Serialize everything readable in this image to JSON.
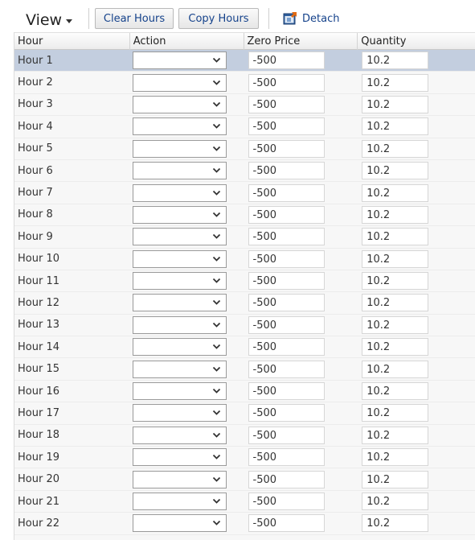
{
  "toolbar": {
    "view_label": "View",
    "clear_hours_label": "Clear Hours",
    "copy_hours_label": "Copy Hours",
    "detach_label": "Detach"
  },
  "columns": {
    "hour": "Hour",
    "action": "Action",
    "zero_price": "Zero Price",
    "quantity": "Quantity"
  },
  "rows": [
    {
      "hour": "Hour 1",
      "action": "",
      "zero_price": "-500",
      "quantity": "10.2"
    },
    {
      "hour": "Hour 2",
      "action": "",
      "zero_price": "-500",
      "quantity": "10.2"
    },
    {
      "hour": "Hour 3",
      "action": "",
      "zero_price": "-500",
      "quantity": "10.2"
    },
    {
      "hour": "Hour 4",
      "action": "",
      "zero_price": "-500",
      "quantity": "10.2"
    },
    {
      "hour": "Hour 5",
      "action": "",
      "zero_price": "-500",
      "quantity": "10.2"
    },
    {
      "hour": "Hour 6",
      "action": "",
      "zero_price": "-500",
      "quantity": "10.2"
    },
    {
      "hour": "Hour 7",
      "action": "",
      "zero_price": "-500",
      "quantity": "10.2"
    },
    {
      "hour": "Hour 8",
      "action": "",
      "zero_price": "-500",
      "quantity": "10.2"
    },
    {
      "hour": "Hour 9",
      "action": "",
      "zero_price": "-500",
      "quantity": "10.2"
    },
    {
      "hour": "Hour 10",
      "action": "",
      "zero_price": "-500",
      "quantity": "10.2"
    },
    {
      "hour": "Hour 11",
      "action": "",
      "zero_price": "-500",
      "quantity": "10.2"
    },
    {
      "hour": "Hour 12",
      "action": "",
      "zero_price": "-500",
      "quantity": "10.2"
    },
    {
      "hour": "Hour 13",
      "action": "",
      "zero_price": "-500",
      "quantity": "10.2"
    },
    {
      "hour": "Hour 14",
      "action": "",
      "zero_price": "-500",
      "quantity": "10.2"
    },
    {
      "hour": "Hour 15",
      "action": "",
      "zero_price": "-500",
      "quantity": "10.2"
    },
    {
      "hour": "Hour 16",
      "action": "",
      "zero_price": "-500",
      "quantity": "10.2"
    },
    {
      "hour": "Hour 17",
      "action": "",
      "zero_price": "-500",
      "quantity": "10.2"
    },
    {
      "hour": "Hour 18",
      "action": "",
      "zero_price": "-500",
      "quantity": "10.2"
    },
    {
      "hour": "Hour 19",
      "action": "",
      "zero_price": "-500",
      "quantity": "10.2"
    },
    {
      "hour": "Hour 20",
      "action": "",
      "zero_price": "-500",
      "quantity": "10.2"
    },
    {
      "hour": "Hour 21",
      "action": "",
      "zero_price": "-500",
      "quantity": "10.2"
    },
    {
      "hour": "Hour 22",
      "action": "",
      "zero_price": "-500",
      "quantity": "10.2"
    }
  ],
  "selected_row": 0,
  "icons": {
    "view_menu": "chevron-down-icon",
    "detach": "detach-window-icon",
    "select_dropdown": "chevron-down-icon"
  },
  "colors": {
    "selected_row_bg": "#c3cedf",
    "button_text": "#15428b",
    "grid_bg": "#f7f7f7"
  }
}
